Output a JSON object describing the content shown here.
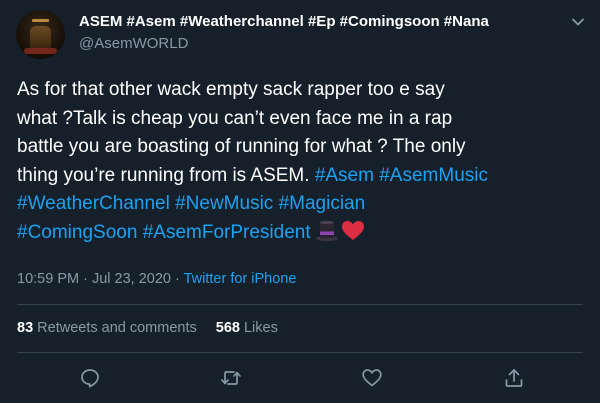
{
  "user": {
    "display_name": "ASEM #Asem #Weatherchannel #Ep #Comingsoon #Nana",
    "handle": "@AsemWORLD"
  },
  "tweet": {
    "line1": "As for that other wack empty sack rapper too e say",
    "line2": "what ?Talk is cheap you can’t even face me in a rap",
    "line3": "battle you are boasting of running for what ? The only",
    "line4_text": "thing you’re running from is ASEM. ",
    "hashtags": [
      "#Asem",
      "#AsemMusic",
      "#WeatherChannel",
      "#NewMusic",
      "#Magician",
      "#ComingSoon",
      "#AsemForPresident"
    ],
    "emojis": [
      "top-hat-emoji",
      "red-heart-emoji"
    ]
  },
  "meta": {
    "timestamp": "10:59 PM · Jul 23, 2020",
    "separator": " · ",
    "source": "Twitter for iPhone"
  },
  "stats": {
    "retweets_count": "83",
    "retweets_label": " Retweets and comments",
    "likes_count": "568",
    "likes_label": " Likes"
  },
  "actions": [
    "reply-icon",
    "retweet-icon",
    "like-icon",
    "share-icon"
  ],
  "colors": {
    "background": "#15202b",
    "text": "#ffffff",
    "secondary": "#8899a6",
    "link": "#1da1f2",
    "divider": "#38444d"
  }
}
